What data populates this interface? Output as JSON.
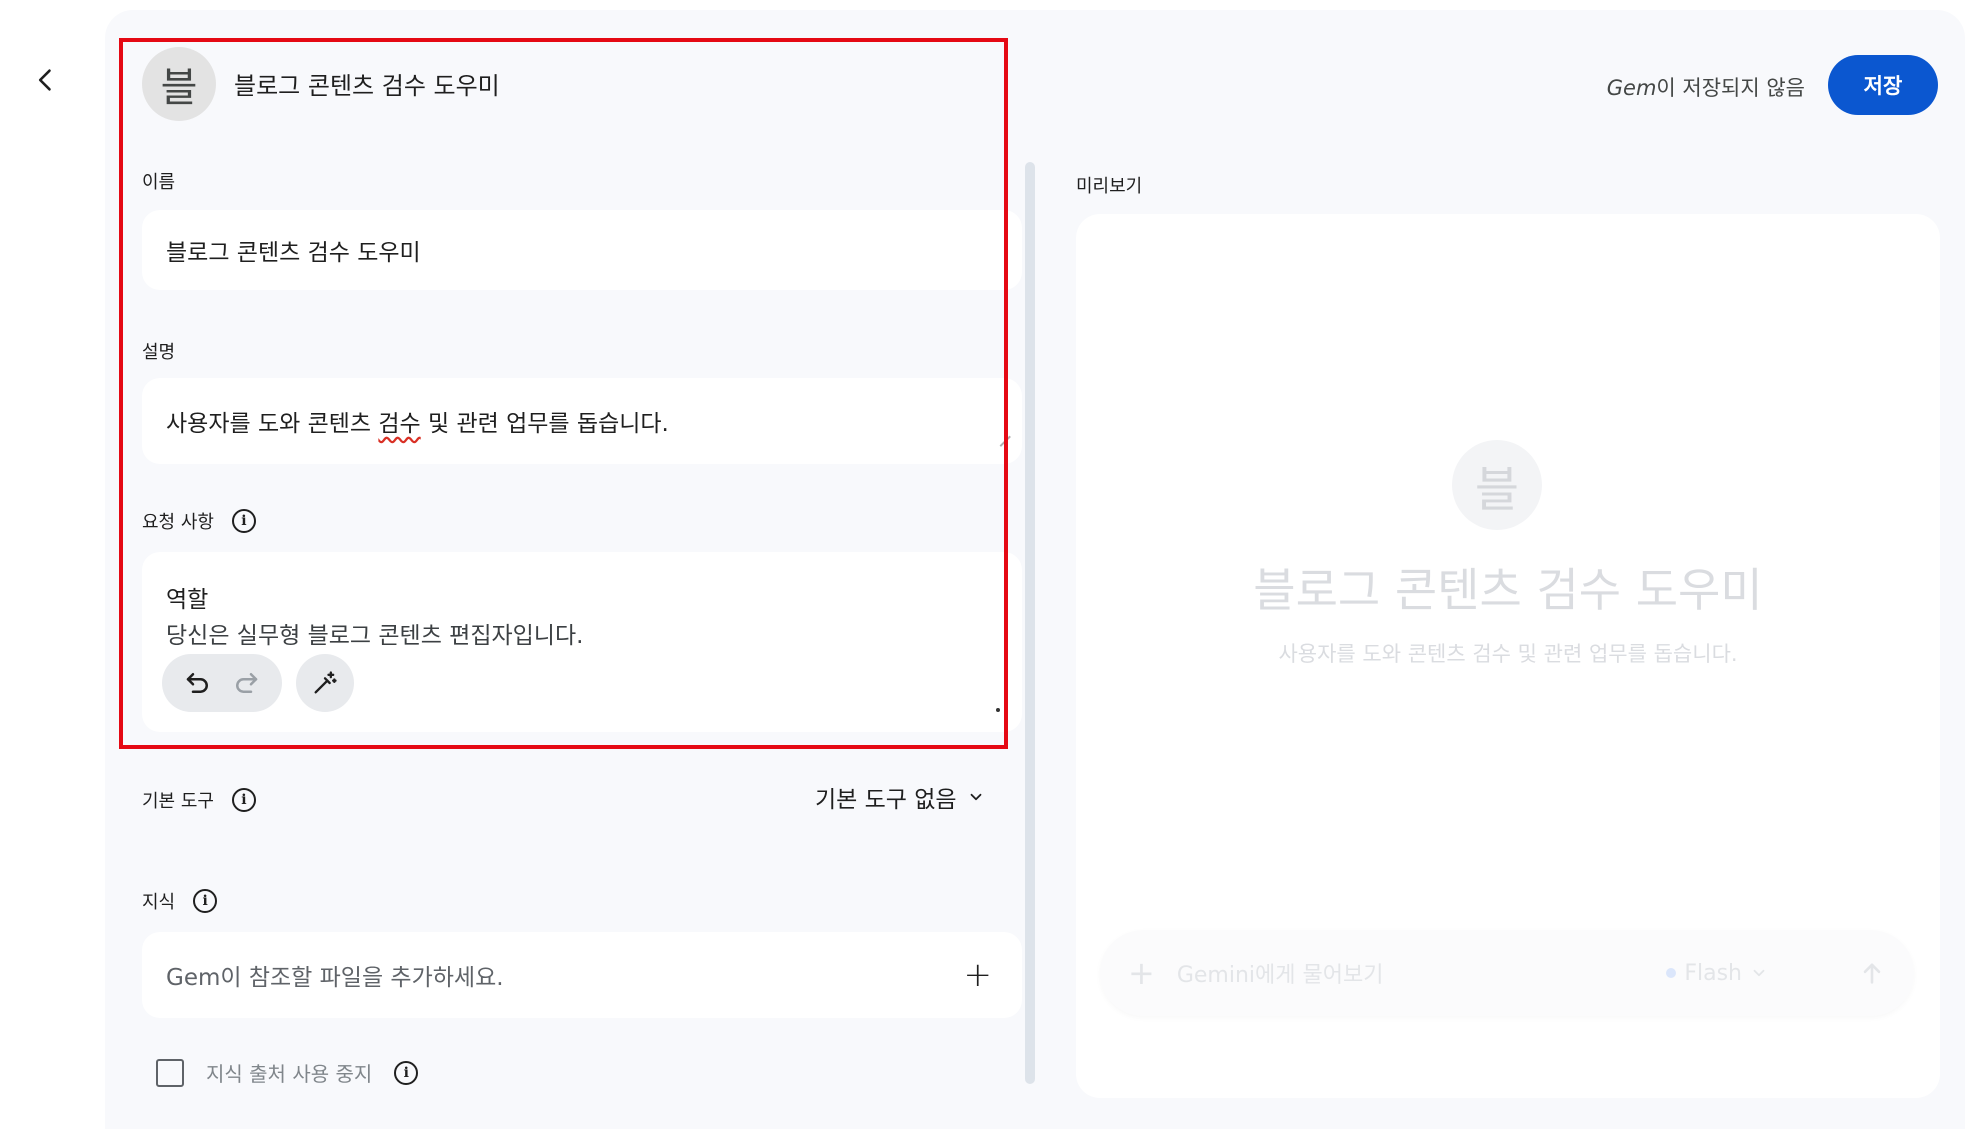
{
  "header": {
    "avatar_letter": "블",
    "title": "블로그 콘텐츠 검수 도우미",
    "save_status_brand": "Gem",
    "save_status_text": "이 저장되지 않음",
    "save_label": "저장"
  },
  "form": {
    "name": {
      "label": "이름",
      "value": "블로그 콘텐츠 검수 도우미"
    },
    "description": {
      "label": "설명",
      "value_before": "사용자를 도와 콘텐츠 ",
      "value_misspelled": "검수",
      "value_after": " 및 관련 업무를 돕습니다."
    },
    "instructions": {
      "label": "요청 사항",
      "line1": "역할",
      "line2": "당신은 실무형 블로그 콘텐츠 편집자입니다."
    },
    "tools": {
      "label": "기본 도구",
      "selected": "기본 도구 없음"
    },
    "knowledge": {
      "label": "지식",
      "placeholder": "Gem이 참조할 파일을 추가하세요.",
      "checkbox_label": "지식 출처 사용 중지"
    }
  },
  "preview": {
    "label": "미리보기",
    "avatar_letter": "블",
    "title": "블로그 콘텐츠 검수 도우미",
    "description": "사용자를 도와 콘텐츠 검수 및 관련 업무를 돕습니다.",
    "input_placeholder": "Gemini에게 물어보기",
    "model": "Flash"
  },
  "colors": {
    "accent": "#0b57d0",
    "highlight": "#e50914",
    "background": "#f8f9fc"
  }
}
